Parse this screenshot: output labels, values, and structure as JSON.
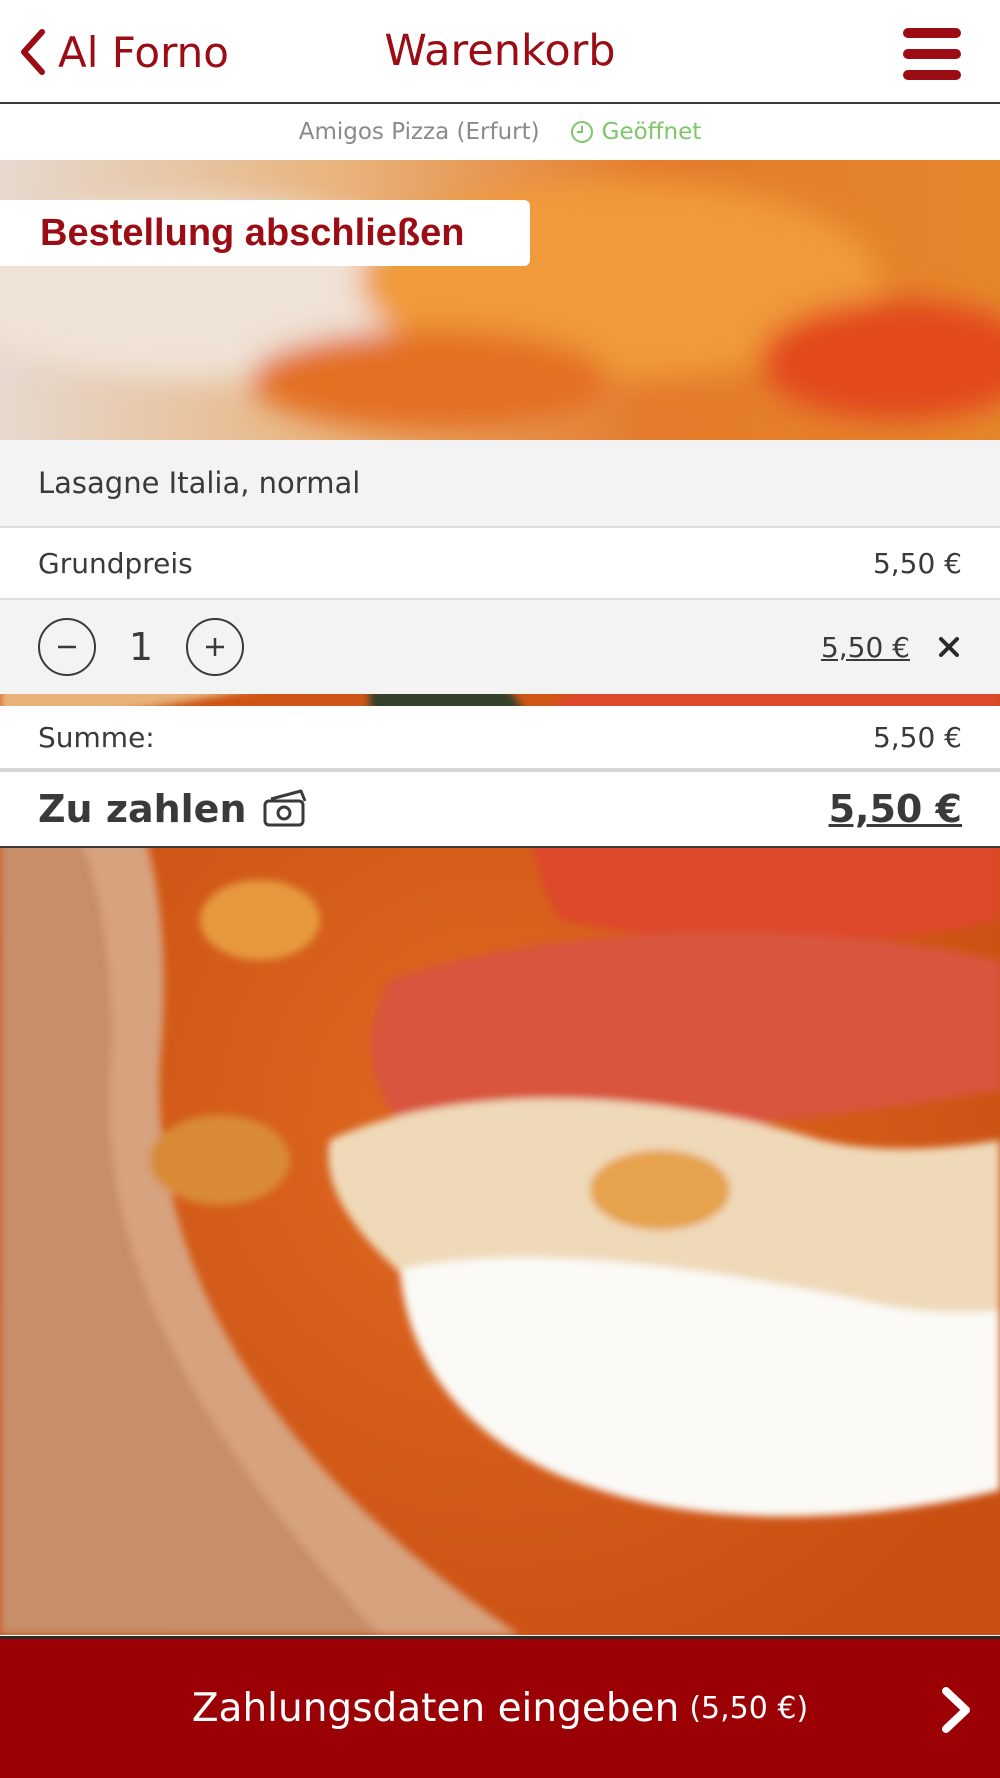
{
  "header": {
    "back_label": "Al Forno",
    "title": "Warenkorb",
    "back_icon": "chevron-left-icon",
    "menu_icon": "hamburger-menu-icon"
  },
  "store": {
    "name": "Amigos Pizza (Erfurt)",
    "status": "Geöffnet",
    "status_icon": "clock-icon"
  },
  "section": {
    "heading": "Bestellung abschließen"
  },
  "cart": {
    "item": {
      "name": "Lasagne Italia, normal",
      "base_price_label": "Grundpreis",
      "base_price": "5,50 €",
      "quantity": "1",
      "line_total": "5,50 €"
    },
    "sum_label": "Summe:",
    "sum_value": "5,50 €",
    "total_label": "Zu zahlen",
    "total_value": "5,50 €",
    "total_icon": "cash-icon"
  },
  "cta": {
    "label": "Zahlungsdaten eingeben",
    "amount": "(5,50 €)",
    "icon": "chevron-right-icon"
  },
  "colors": {
    "brand": "#9b0c14",
    "cta_background": "#9b0004",
    "status_open": "#7dc66a"
  }
}
